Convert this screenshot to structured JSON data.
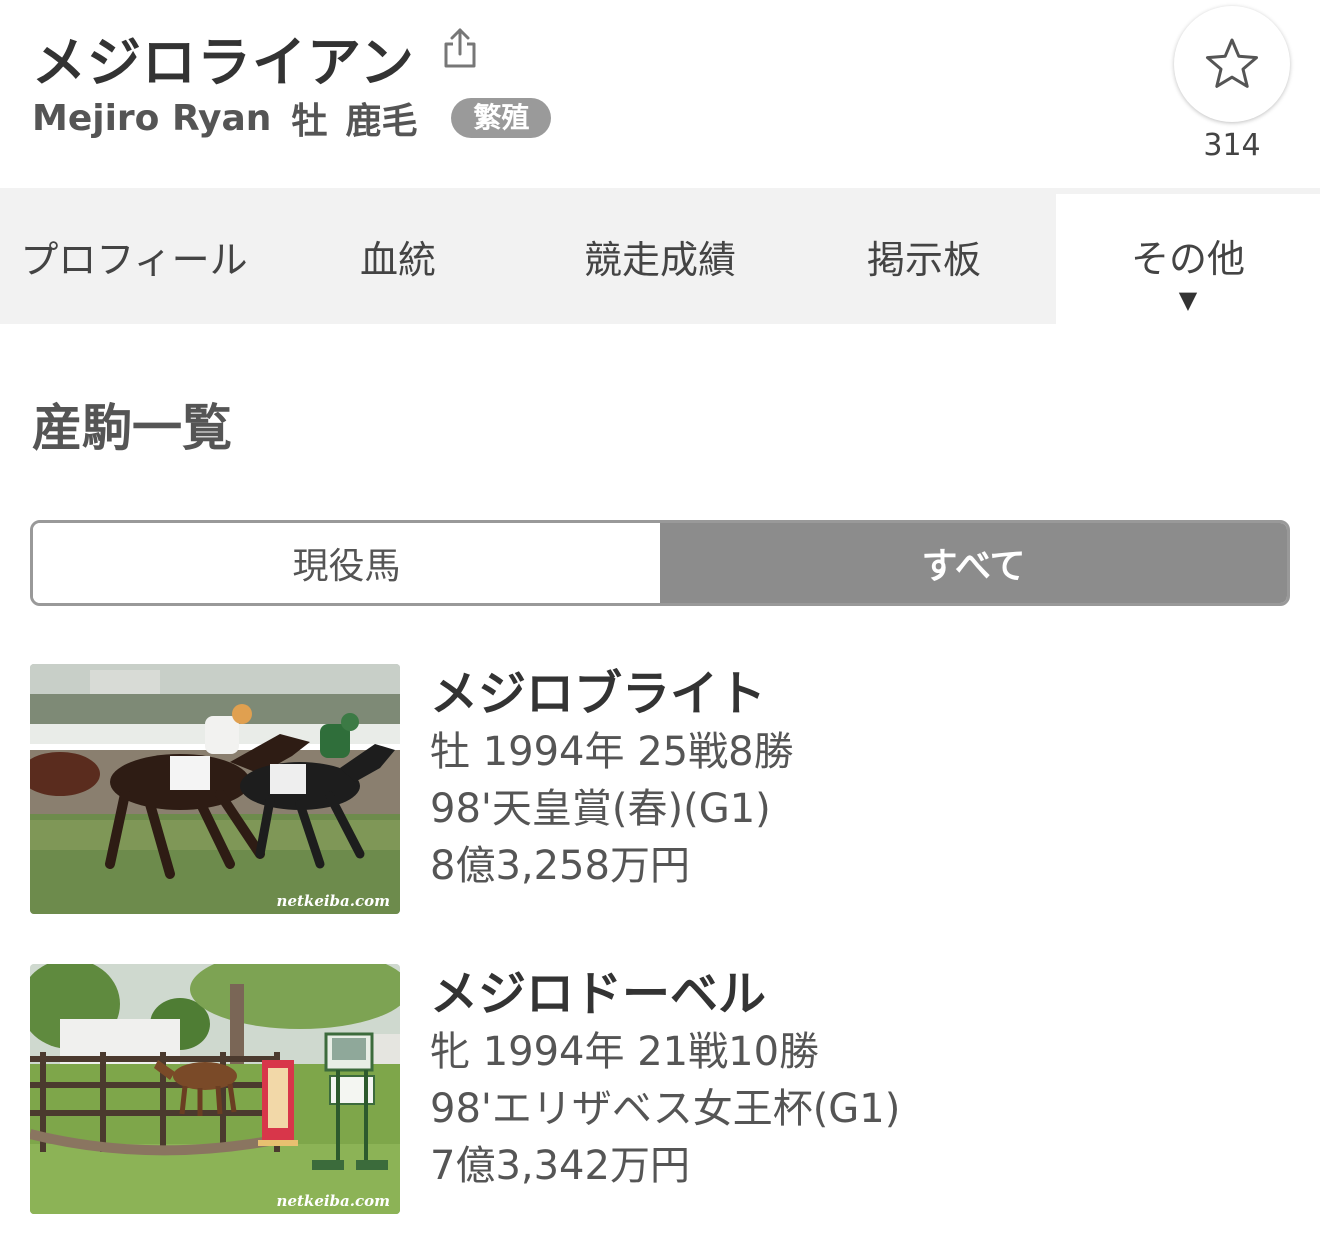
{
  "horse": {
    "name": "メジロライアン",
    "name_en": "Mejiro Ryan",
    "sex": "牡",
    "color": "鹿毛",
    "status_badge": "繁殖"
  },
  "favorite": {
    "count": "314",
    "icon": "star-icon"
  },
  "tabs": [
    {
      "label": "プロフィール"
    },
    {
      "label": "血統"
    },
    {
      "label": "競走成績"
    },
    {
      "label": "掲示板"
    },
    {
      "label": "その他",
      "active": true
    }
  ],
  "section": {
    "title": "産駒一覧"
  },
  "filter": {
    "options": [
      "現役馬",
      "すべて"
    ],
    "selected": "すべて"
  },
  "offspring": [
    {
      "name": "メジロブライト",
      "summary": "牡 1994年 25戦8勝",
      "title": "98'天皇賞(春)(G1)",
      "earnings": "8億3,258万円",
      "photo_credit": "netkeiba.com"
    },
    {
      "name": "メジロドーベル",
      "summary": "牝 1994年 21戦10勝",
      "title": "98'エリザベス女王杯(G1)",
      "earnings": "7億3,342万円",
      "photo_credit": "netkeiba.com"
    }
  ],
  "colors": {
    "tab_bg": "#f2f2f2",
    "badge_bg": "#9a9a9a",
    "toggle_selected": "#8c8c8c"
  }
}
